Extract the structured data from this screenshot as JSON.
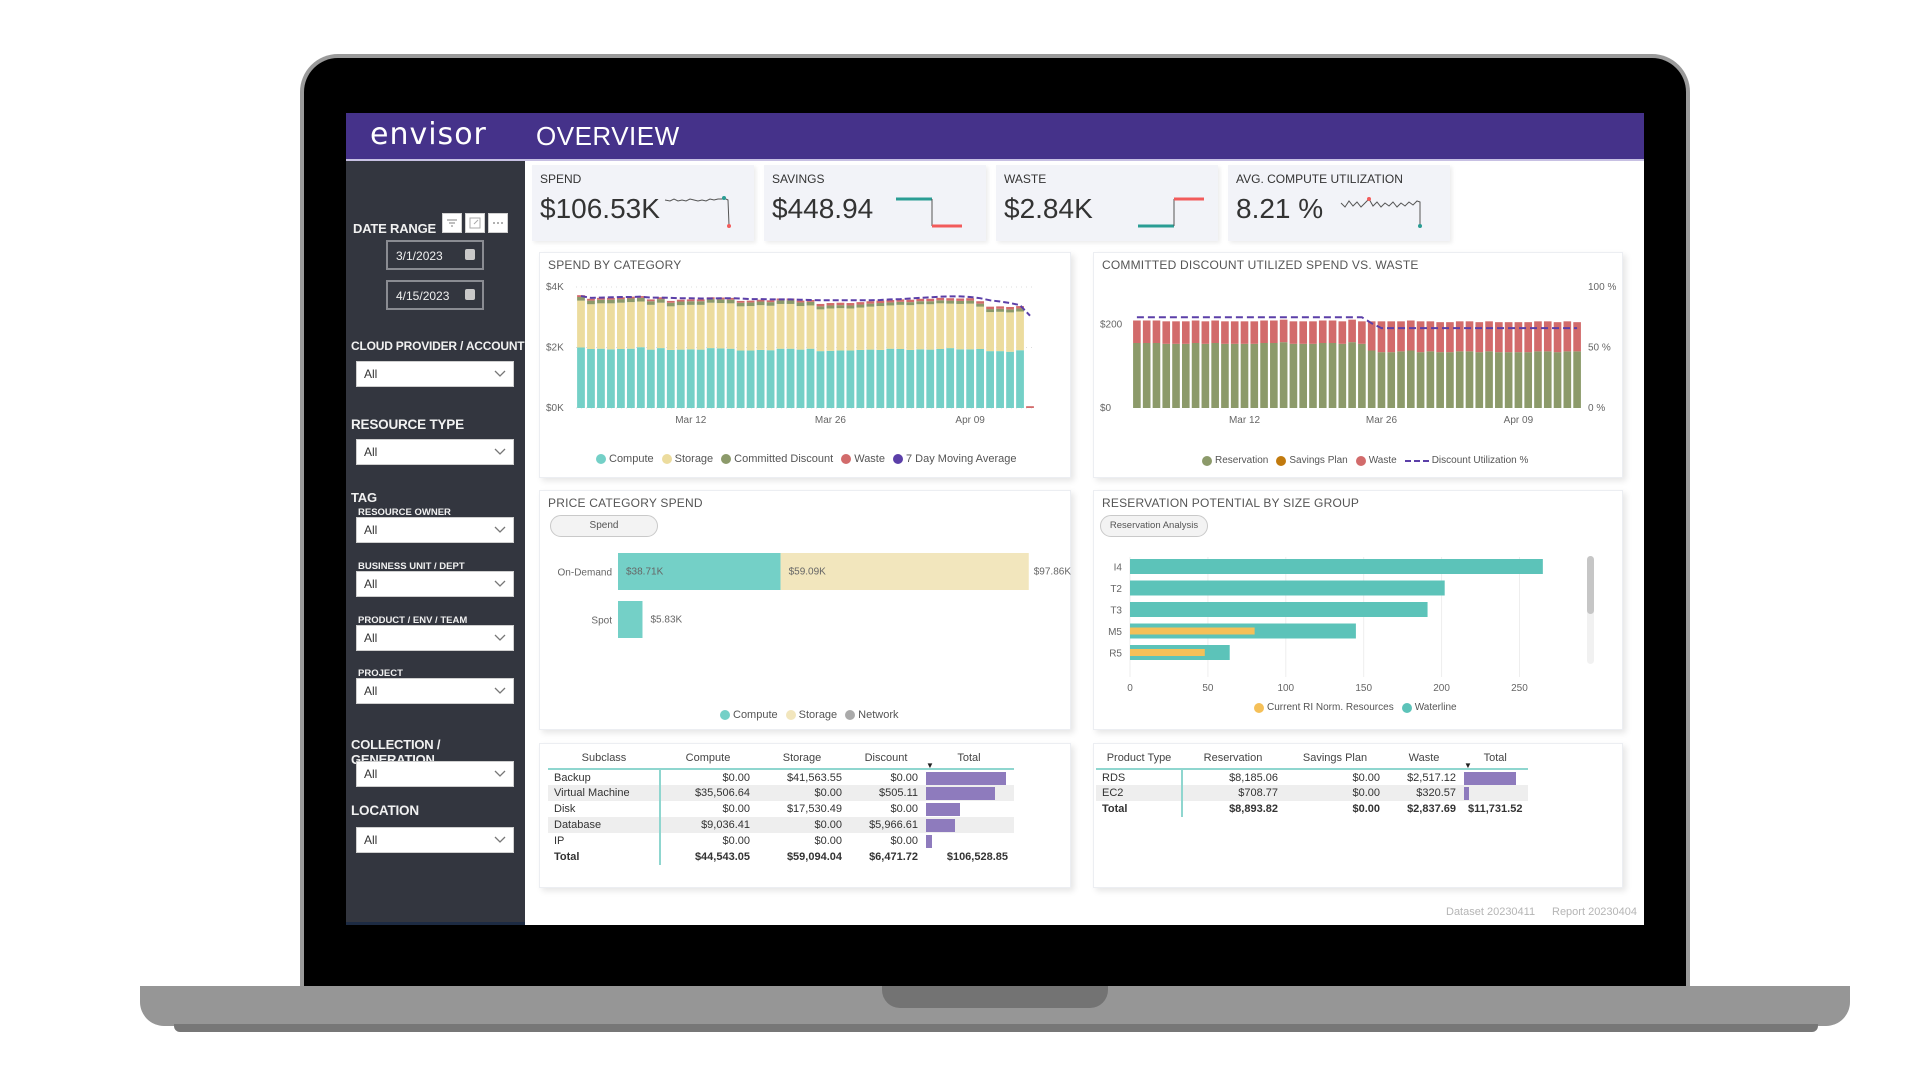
{
  "app": {
    "logo": "envisor",
    "page_title": "OVERVIEW"
  },
  "sidebar": {
    "date_range_label": "DATE RANGE",
    "date_start": "3/1/2023",
    "date_end": "4/15/2023",
    "header_icons": [
      "filter-icon",
      "focus-mode-icon",
      "more-options-icon"
    ],
    "filters": [
      {
        "label": "CLOUD PROVIDER / ACCOUNT",
        "value": "All"
      },
      {
        "label": "RESOURCE TYPE",
        "value": "All"
      }
    ],
    "tag_label": "TAG",
    "tag_filters": [
      {
        "label": "RESOURCE OWNER",
        "value": "All"
      },
      {
        "label": "BUSINESS UNIT / DEPT",
        "value": "All"
      },
      {
        "label": "PRODUCT / ENV / TEAM",
        "value": "All"
      },
      {
        "label": "PROJECT",
        "value": "All"
      }
    ],
    "bottom_filters": [
      {
        "label": "COLLECTION / GENERATION",
        "value": "All"
      },
      {
        "label": "LOCATION",
        "value": "All"
      }
    ]
  },
  "kpis": [
    {
      "label": "SPEND",
      "value": "$106.53K"
    },
    {
      "label": "SAVINGS",
      "value": "$448.94"
    },
    {
      "label": "WASTE",
      "value": "$2.84K"
    },
    {
      "label": "AVG. COMPUTE UTILIZATION",
      "value": "8.21 %"
    }
  ],
  "colors": {
    "brand": "#45328a",
    "compute": "#74d0c7",
    "storage": "#ecdc9e",
    "committed": "#8c9a6a",
    "waste": "#d26b6b",
    "moving_avg": "#5b3fa8",
    "reservation": "#8c9a6a",
    "savings_plan": "#c17a0e",
    "current_ri": "#f5c058",
    "waterline": "#5cc3b9",
    "network": "#aaaaaa",
    "table_bar": "#8e7bbd"
  },
  "chart_data": [
    {
      "id": "spend_by_category",
      "type": "bar",
      "stacked": true,
      "title": "SPEND BY CATEGORY",
      "xlabel": "",
      "ylabel": "",
      "ylim": [
        0,
        4000
      ],
      "yticks": [
        "$0K",
        "$2K",
        "$4K"
      ],
      "xticks": [
        "Mar 12",
        "Mar 26",
        "Apr 09"
      ],
      "grid": true,
      "legend": "bottom",
      "legend_items": [
        "Compute",
        "Storage",
        "Committed Discount",
        "Waste",
        "7 Day Moving Average"
      ],
      "days": 46,
      "series": [
        {
          "name": "Compute",
          "values": [
            2000,
            1950,
            1960,
            1940,
            1950,
            1960,
            2010,
            1930,
            1980,
            1920,
            1930,
            1940,
            1930,
            1980,
            1970,
            1960,
            1900,
            1900,
            1920,
            1910,
            1960,
            1960,
            1930,
            1960,
            1880,
            1890,
            1900,
            1900,
            1920,
            1930,
            1920,
            1960,
            1950,
            1920,
            1940,
            1930,
            1950,
            1980,
            1940,
            1940,
            1950,
            1880,
            1880,
            1860,
            1910,
            0
          ]
        },
        {
          "name": "Storage",
          "values": [
            1550,
            1480,
            1500,
            1520,
            1530,
            1540,
            1510,
            1480,
            1500,
            1440,
            1470,
            1470,
            1480,
            1500,
            1500,
            1500,
            1460,
            1470,
            1480,
            1470,
            1480,
            1480,
            1440,
            1430,
            1380,
            1400,
            1400,
            1390,
            1400,
            1420,
            1450,
            1430,
            1460,
            1480,
            1490,
            1500,
            1510,
            1470,
            1500,
            1510,
            1400,
            1290,
            1300,
            1300,
            1280,
            0
          ]
        },
        {
          "name": "Committed Discount",
          "values": [
            120,
            120,
            120,
            120,
            120,
            120,
            120,
            120,
            120,
            120,
            120,
            120,
            120,
            120,
            120,
            120,
            120,
            120,
            120,
            120,
            120,
            120,
            120,
            120,
            100,
            100,
            100,
            100,
            100,
            100,
            100,
            100,
            100,
            100,
            100,
            100,
            100,
            100,
            100,
            100,
            100,
            100,
            100,
            100,
            100,
            0
          ]
        },
        {
          "name": "Waste",
          "values": [
            60,
            60,
            60,
            60,
            60,
            60,
            60,
            60,
            60,
            60,
            60,
            60,
            60,
            60,
            60,
            60,
            60,
            60,
            60,
            60,
            60,
            60,
            60,
            60,
            80,
            80,
            80,
            80,
            80,
            80,
            80,
            80,
            80,
            80,
            80,
            80,
            80,
            80,
            80,
            80,
            80,
            80,
            80,
            80,
            80,
            60
          ]
        },
        {
          "name": "7 Day Moving Average",
          "values": [
            3700,
            3640,
            3650,
            3660,
            3670,
            3670,
            3680,
            3650,
            3650,
            3640,
            3630,
            3630,
            3620,
            3620,
            3630,
            3630,
            3620,
            3600,
            3600,
            3590,
            3590,
            3590,
            3580,
            3570,
            3560,
            3560,
            3560,
            3560,
            3560,
            3560,
            3570,
            3590,
            3600,
            3620,
            3640,
            3660,
            3680,
            3690,
            3690,
            3670,
            3630,
            3560,
            3520,
            3470,
            3400,
            3050
          ]
        }
      ]
    },
    {
      "id": "committed_discount",
      "type": "bar",
      "stacked": true,
      "title": "COMMITTED DISCOUNT UTILIZED SPEND VS. WASTE",
      "ylim": [
        0,
        300
      ],
      "yticks": [
        "$0",
        "$200"
      ],
      "y2ticks": [
        "0 %",
        "50 %",
        "100 %"
      ],
      "xticks": [
        "Mar 12",
        "Mar 26",
        "Apr 09"
      ],
      "legend": "bottom",
      "legend_items": [
        "Reservation",
        "Savings Plan",
        "Waste",
        "Discount Utilization %"
      ],
      "days": 46,
      "series": [
        {
          "name": "Reservation",
          "values": [
            156,
            156,
            156,
            154,
            154,
            154,
            156,
            154,
            156,
            154,
            154,
            154,
            154,
            156,
            156,
            158,
            154,
            154,
            154,
            156,
            156,
            154,
            158,
            154,
            138,
            134,
            134,
            136,
            138,
            134,
            136,
            134,
            134,
            136,
            136,
            134,
            136,
            134,
            134,
            134,
            134,
            136,
            136,
            134,
            136,
            136
          ]
        },
        {
          "name": "Savings Plan",
          "values": [
            0,
            0,
            0,
            0,
            0,
            0,
            0,
            0,
            0,
            0,
            0,
            0,
            0,
            0,
            0,
            0,
            0,
            0,
            0,
            0,
            0,
            0,
            0,
            0,
            0,
            0,
            0,
            0,
            0,
            0,
            0,
            0,
            0,
            0,
            0,
            0,
            0,
            0,
            0,
            0,
            0,
            0,
            0,
            0,
            0,
            0
          ]
        },
        {
          "name": "Waste",
          "values": [
            54,
            54,
            54,
            54,
            54,
            54,
            54,
            54,
            54,
            54,
            54,
            54,
            54,
            54,
            54,
            54,
            54,
            54,
            54,
            54,
            54,
            54,
            54,
            54,
            70,
            74,
            74,
            72,
            72,
            74,
            72,
            72,
            72,
            72,
            72,
            72,
            72,
            72,
            72,
            72,
            72,
            72,
            72,
            72,
            72,
            70
          ]
        },
        {
          "name": "Discount Utilization %",
          "values": [
            75,
            75,
            75,
            75,
            75,
            75,
            75,
            75,
            75,
            75,
            75,
            75,
            75,
            75,
            75,
            75,
            75,
            75,
            75,
            75,
            75,
            75,
            75,
            75,
            70,
            66,
            66,
            66,
            66,
            66,
            66,
            66,
            66,
            66,
            66,
            66,
            66,
            66,
            66,
            66,
            66,
            66,
            66,
            66,
            66,
            66
          ]
        }
      ]
    },
    {
      "id": "price_category_spend",
      "type": "bar",
      "orientation": "horizontal",
      "stacked": true,
      "title": "PRICE CATEGORY SPEND",
      "toggle_label": "Spend",
      "categories": [
        "On-Demand",
        "Spot"
      ],
      "series": [
        {
          "name": "Compute",
          "values": [
            38.71,
            5.83
          ],
          "labels": [
            "$38.71K",
            "$5.83K"
          ]
        },
        {
          "name": "Storage",
          "values": [
            59.09,
            0
          ],
          "labels": [
            "$59.09K",
            ""
          ]
        },
        {
          "name": "Network",
          "values": [
            0,
            0
          ],
          "labels": [
            "",
            ""
          ]
        }
      ],
      "totals": [
        "$97.86K",
        ""
      ],
      "xlim": [
        0,
        100
      ],
      "legend": "bottom",
      "legend_items": [
        "Compute",
        "Storage",
        "Network"
      ]
    },
    {
      "id": "reservation_potential",
      "type": "bar",
      "orientation": "horizontal",
      "title": "RESERVATION POTENTIAL BY SIZE GROUP",
      "toggle_label": "Reservation Analysis",
      "categories": [
        "I4",
        "T2",
        "T3",
        "M5",
        "R5"
      ],
      "series": [
        {
          "name": "Waterline",
          "values": [
            265,
            202,
            191,
            145,
            64
          ]
        },
        {
          "name": "Current RI Norm. Resources",
          "values": [
            0,
            0,
            0,
            80,
            48
          ]
        }
      ],
      "xlim": [
        0,
        285
      ],
      "xticks": [
        "0",
        "50",
        "100",
        "150",
        "200",
        "250"
      ],
      "legend": "bottom",
      "legend_items": [
        "Current RI Norm. Resources",
        "Waterline"
      ]
    }
  ],
  "subclass_table": {
    "columns": [
      "Subclass",
      "Compute",
      "Storage",
      "Discount",
      "Total"
    ],
    "rows": [
      {
        "name": "Backup",
        "compute": "$0.00",
        "storage": "$41,563.55",
        "discount": "$0.00",
        "total_frac": 1.0
      },
      {
        "name": "Virtual Machine",
        "compute": "$35,506.64",
        "storage": "$0.00",
        "discount": "$505.11",
        "total_frac": 0.866
      },
      {
        "name": "Disk",
        "compute": "$0.00",
        "storage": "$17,530.49",
        "discount": "$0.00",
        "total_frac": 0.42
      },
      {
        "name": "Database",
        "compute": "$9,036.41",
        "storage": "$0.00",
        "discount": "$5,966.61",
        "total_frac": 0.36
      },
      {
        "name": "IP",
        "compute": "$0.00",
        "storage": "$0.00",
        "discount": "$0.00",
        "total_frac": 0.07
      }
    ],
    "total": {
      "name": "Total",
      "compute": "$44,543.05",
      "storage": "$59,094.04",
      "discount": "$6,471.72",
      "total": "$106,528.85"
    }
  },
  "product_table": {
    "columns": [
      "Product Type",
      "Reservation",
      "Savings Plan",
      "Waste",
      "Total"
    ],
    "rows": [
      {
        "name": "RDS",
        "reservation": "$8,185.06",
        "savings_plan": "$0.00",
        "waste": "$2,517.12",
        "total_frac": 1.0
      },
      {
        "name": "EC2",
        "reservation": "$708.77",
        "savings_plan": "$0.00",
        "waste": "$320.57",
        "total_frac": 0.096
      }
    ],
    "total": {
      "name": "Total",
      "reservation": "$8,893.82",
      "savings_plan": "$0.00",
      "waste": "$2,837.69",
      "total": "$11,731.52"
    }
  },
  "footer": {
    "dataset": "Dataset 20230411",
    "report": "Report 20230404"
  }
}
